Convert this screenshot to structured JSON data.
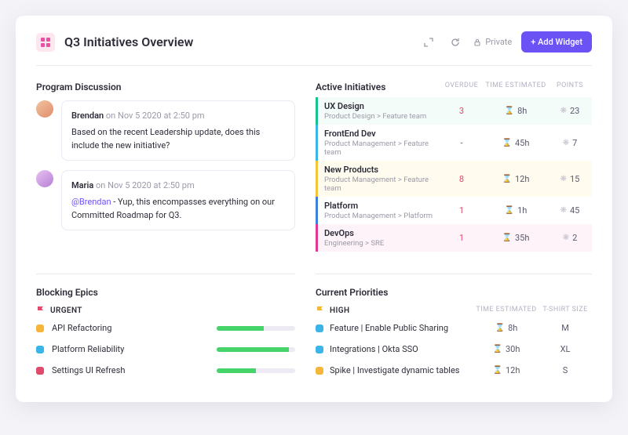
{
  "header": {
    "title": "Q3 Initiatives Overview",
    "private_label": "Private",
    "add_widget_label": "+ Add Widget"
  },
  "discussion": {
    "title": "Program Discussion",
    "comments": [
      {
        "author": "Brendan",
        "meta_prefix": "on",
        "timestamp": "Nov 5 2020 at 2:50 pm",
        "body": "Based on the recent Leadership update, does this include the new initiative?"
      },
      {
        "author": "Maria",
        "meta_prefix": "on",
        "timestamp": "Nov 5 2020 at 2:50 pm",
        "mention": "@Brendan",
        "body": " - Yup, this encompasses everything on our Committed Roadmap for Q3."
      }
    ]
  },
  "initiatives": {
    "title": "Active Initiatives",
    "cols": {
      "overdue": "OVERDUE",
      "time": "TIME ESTIMATED",
      "points": "POINTS"
    },
    "rows": [
      {
        "name": "UX Design",
        "sub": "Product Design > Feature team",
        "overdue": "3",
        "time": "8h",
        "points": "23"
      },
      {
        "name": "FrontEnd Dev",
        "sub": "Product Management > Feature team",
        "overdue": "-",
        "time": "45h",
        "points": "7"
      },
      {
        "name": "New Products",
        "sub": "Product Management > Feature team",
        "overdue": "8",
        "time": "12h",
        "points": "15"
      },
      {
        "name": "Platform",
        "sub": "Product Management > Platform",
        "overdue": "1",
        "time": "1h",
        "points": "45"
      },
      {
        "name": "DevOps",
        "sub": "Engineering > SRE",
        "overdue": "1",
        "time": "35h",
        "points": "2"
      }
    ]
  },
  "blocking": {
    "title": "Blocking Epics",
    "flag_label": "URGENT",
    "flag_color": "#e04a6b",
    "rows": [
      {
        "color": "#f5b63a",
        "name": "API Refactoring",
        "progress": 60
      },
      {
        "color": "#3bb4e8",
        "name": "Platform Reliability",
        "progress": 92
      },
      {
        "color": "#e04a6b",
        "name": "Settings UI Refresh",
        "progress": 50
      }
    ]
  },
  "priorities": {
    "title": "Current Priorities",
    "flag_label": "HIGH",
    "flag_color": "#f5b63a",
    "cols": {
      "time": "TIME ESTIMATED",
      "size": "T-SHIRT SIZE"
    },
    "rows": [
      {
        "color": "#3bb4e8",
        "name": "Feature | Enable Public Sharing",
        "time": "8h",
        "size": "M"
      },
      {
        "color": "#3bb4e8",
        "name": "Integrations | Okta SSO",
        "time": "30h",
        "size": "XL"
      },
      {
        "color": "#f5b63a",
        "name": "Spike | Investigate dynamic tables",
        "time": "12h",
        "size": "S"
      }
    ]
  }
}
